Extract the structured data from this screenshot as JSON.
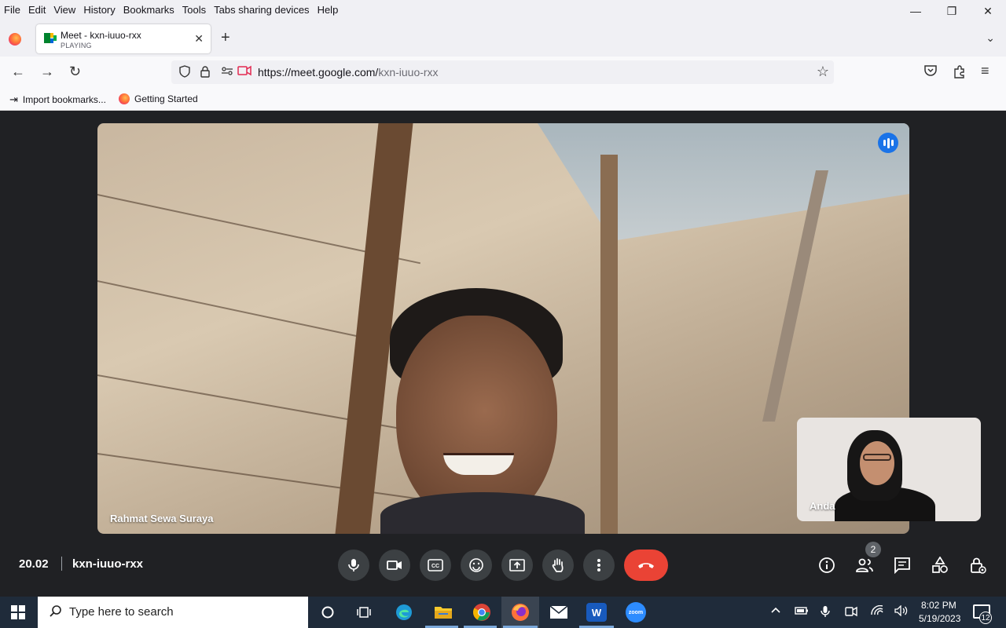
{
  "browser": {
    "menu": [
      "File",
      "Edit",
      "View",
      "History",
      "Bookmarks",
      "Tools",
      "Tabs sharing devices",
      "Help"
    ],
    "window_controls": {
      "minimize": "—",
      "restore": "❐",
      "close": "✕"
    },
    "tab": {
      "title": "Meet - kxn-iuuo-rxx",
      "status": "PLAYING",
      "close": "✕"
    },
    "new_tab": "+",
    "tab_list": "⌄",
    "url": {
      "host": "https://meet.google.com/",
      "path": "kxn-iuuo-rxx"
    },
    "bookmarks": [
      {
        "label": "Import bookmarks..."
      },
      {
        "label": "Getting Started"
      }
    ],
    "nav": {
      "back": "←",
      "forward": "→",
      "reload": "↻",
      "bookmark_star": "☆",
      "pocket": "⌂",
      "extensions": "⧉",
      "menu": "≡"
    }
  },
  "meet": {
    "main_participant": "Rahmat Sewa Suraya",
    "self_participant": "Anda",
    "time": "20.02",
    "meeting_code": "kxn-iuuo-rxx",
    "participant_count": "2",
    "accent": "#1a73e8",
    "end_call_color": "#ea4335"
  },
  "taskbar": {
    "search_placeholder": "Type here to search",
    "clock_time": "8:02 PM",
    "clock_date": "5/19/2023",
    "notification_count": "12",
    "apps": [
      "edge-icon",
      "file-explorer-icon",
      "chrome-icon",
      "firefox-icon",
      "mail-icon",
      "word-icon",
      "zoom-icon"
    ],
    "zoom_label": "zoom",
    "word_label": "W"
  }
}
